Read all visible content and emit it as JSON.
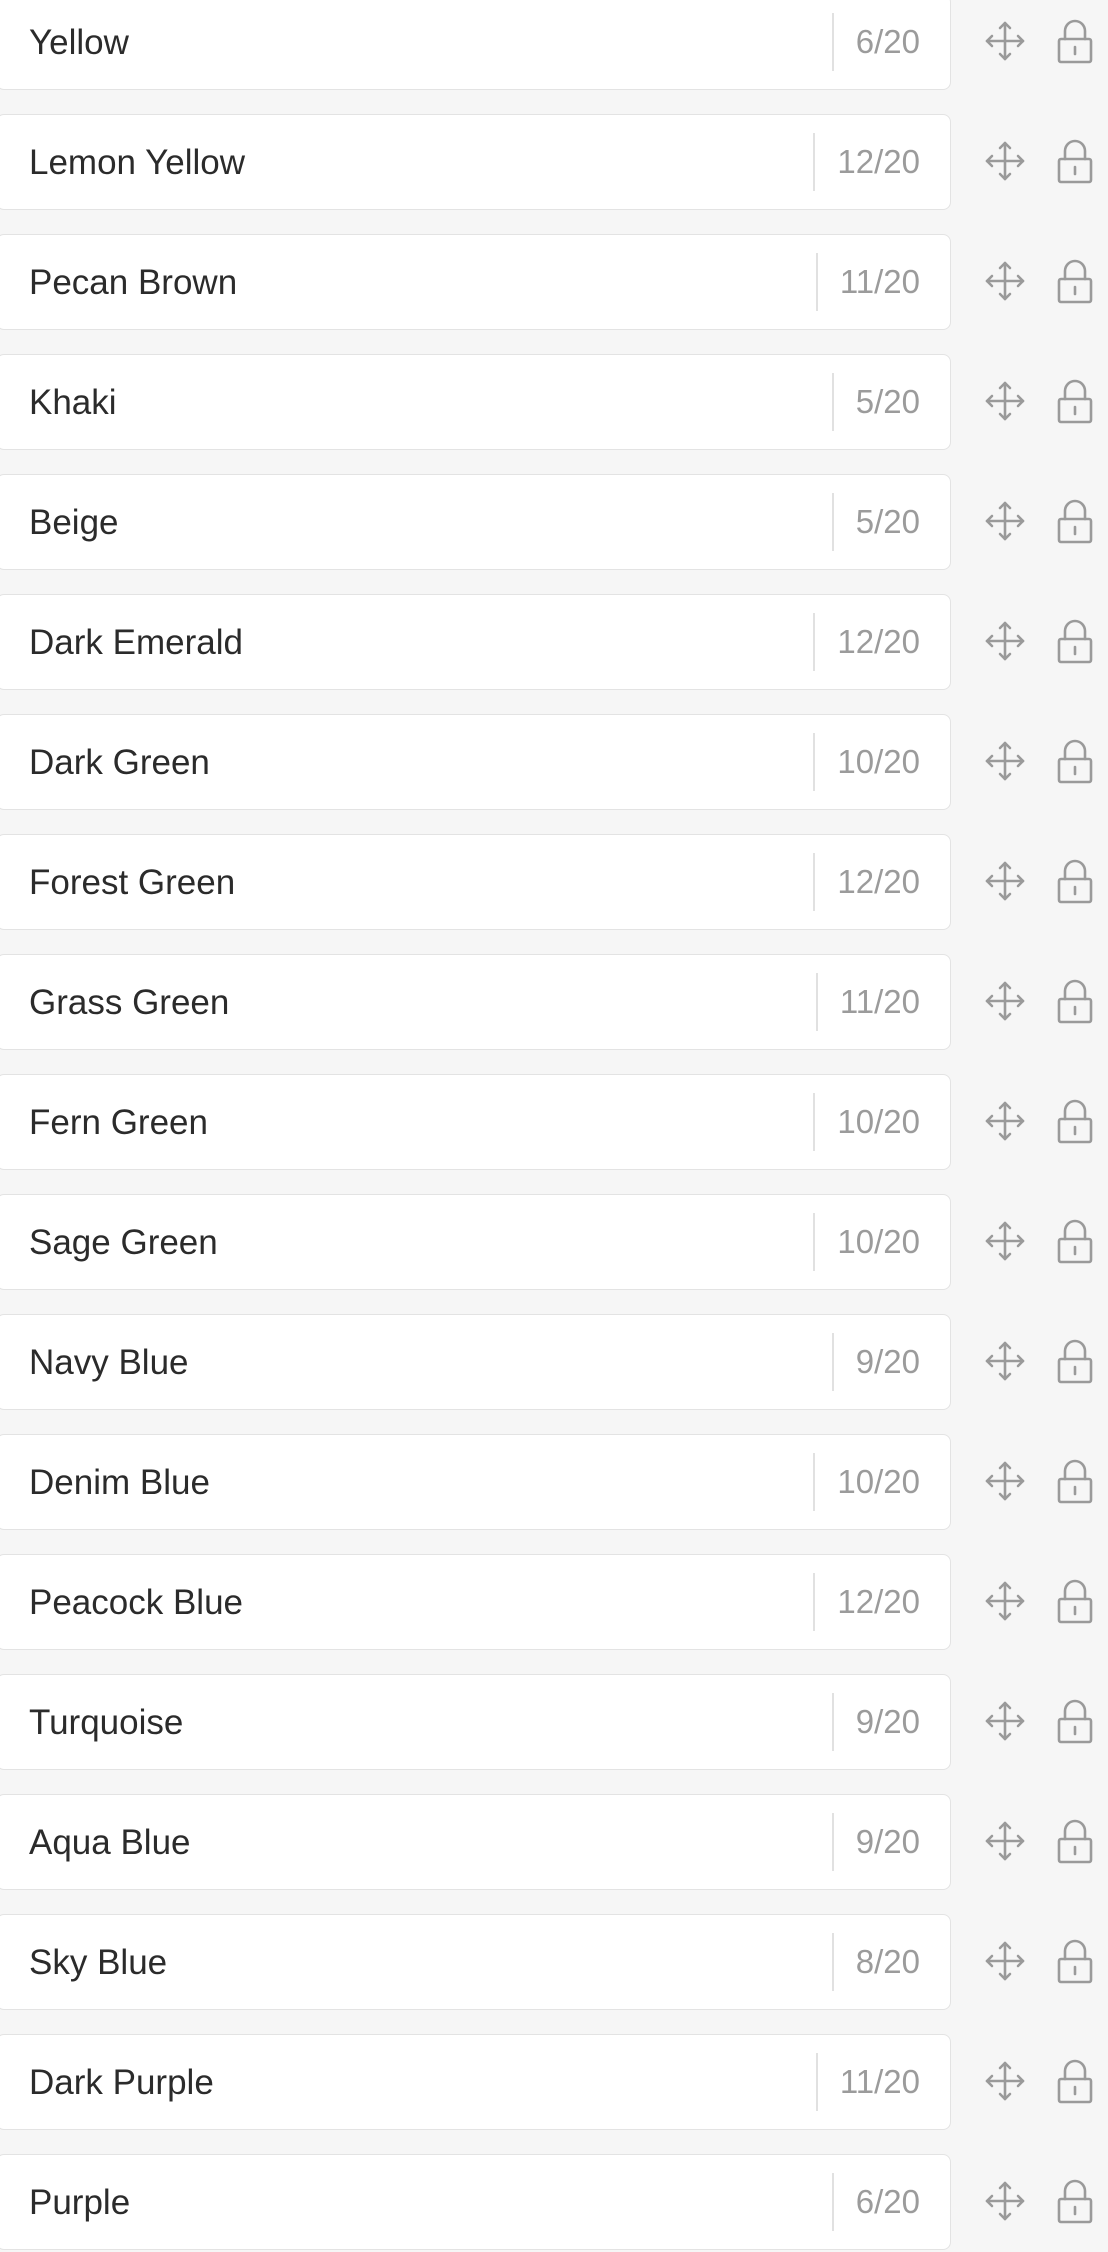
{
  "colors": {
    "page_background": "#f6f6f6",
    "field_background": "#ffffff",
    "field_border": "#e3e3e3",
    "text": "#2b2b2b",
    "counter_text": "#9b9b9b",
    "icon": "#9a9a9a"
  },
  "icons": {
    "move": "move-arrows-icon",
    "lock": "lock-icon"
  },
  "items": [
    {
      "value": "Yellow",
      "counter": "6/20"
    },
    {
      "value": "Lemon Yellow",
      "counter": "12/20"
    },
    {
      "value": "Pecan Brown",
      "counter": "11/20"
    },
    {
      "value": "Khaki",
      "counter": "5/20"
    },
    {
      "value": "Beige",
      "counter": "5/20"
    },
    {
      "value": "Dark Emerald",
      "counter": "12/20"
    },
    {
      "value": "Dark Green",
      "counter": "10/20"
    },
    {
      "value": "Forest Green",
      "counter": "12/20"
    },
    {
      "value": "Grass Green",
      "counter": "11/20"
    },
    {
      "value": "Fern Green",
      "counter": "10/20"
    },
    {
      "value": "Sage Green",
      "counter": "10/20"
    },
    {
      "value": "Navy Blue",
      "counter": "9/20"
    },
    {
      "value": "Denim Blue",
      "counter": "10/20"
    },
    {
      "value": "Peacock Blue",
      "counter": "12/20"
    },
    {
      "value": "Turquoise",
      "counter": "9/20"
    },
    {
      "value": "Aqua Blue",
      "counter": "9/20"
    },
    {
      "value": "Sky Blue",
      "counter": "8/20"
    },
    {
      "value": "Dark Purple",
      "counter": "11/20"
    },
    {
      "value": "Purple",
      "counter": "6/20"
    }
  ]
}
